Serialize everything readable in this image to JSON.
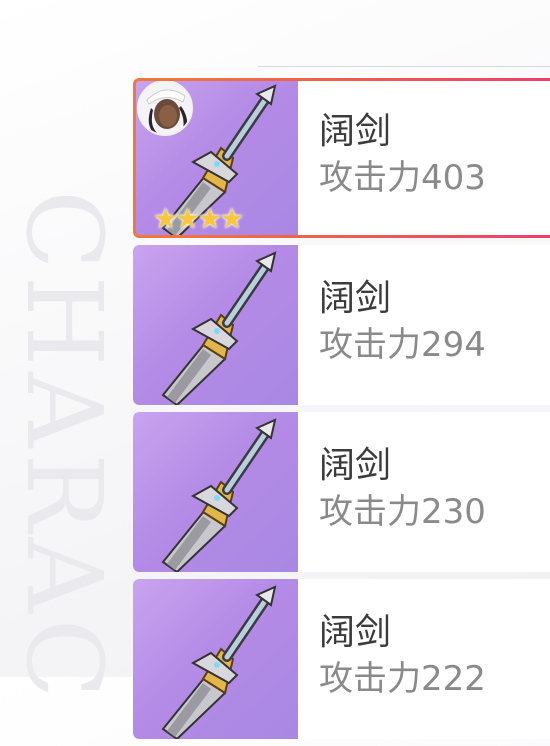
{
  "watermark": "CHARAC",
  "weapons": [
    {
      "name": "阔剑",
      "atk_label": "攻击力",
      "atk_value": "403",
      "selected": true,
      "equipped": true,
      "stars": "★★★★"
    },
    {
      "name": "阔剑",
      "atk_label": "攻击力",
      "atk_value": "294",
      "selected": false,
      "equipped": false
    },
    {
      "name": "阔剑",
      "atk_label": "攻击力",
      "atk_value": "230",
      "selected": false,
      "equipped": false
    },
    {
      "name": "阔剑",
      "atk_label": "攻击力",
      "atk_value": "222",
      "selected": false,
      "equipped": false
    }
  ],
  "colors": {
    "selected_border_start": "#f07a35",
    "selected_border_end": "#ee3f6b",
    "thumb_bg": "#b48be6",
    "star": "#f7c83a"
  }
}
